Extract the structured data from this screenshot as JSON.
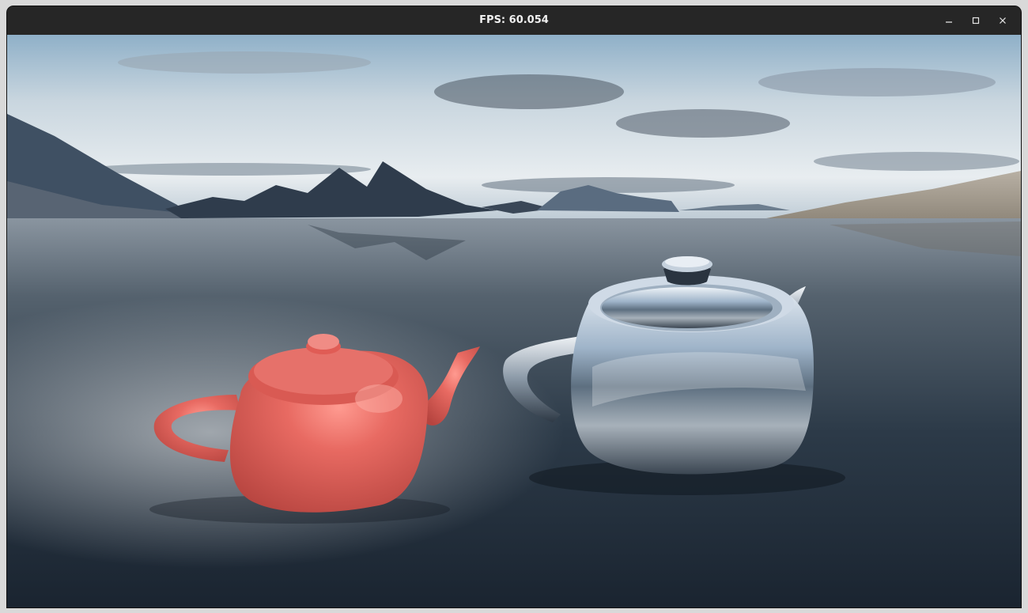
{
  "window": {
    "title": "FPS: 60.054",
    "controls": {
      "minimize_icon": "minimize-icon",
      "maximize_icon": "maximize-icon",
      "close_icon": "close-icon"
    }
  },
  "scene": {
    "description_items": [],
    "colors": {
      "sky_top": "#5f7f98",
      "sky_bottom": "#e8edf0",
      "water": "#233142",
      "red_teapot": "#e0605a",
      "chrome_teapot": "#c8d6e5"
    }
  }
}
